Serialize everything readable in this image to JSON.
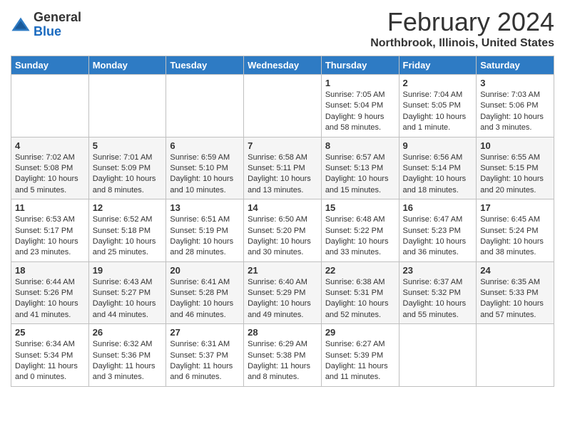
{
  "app": {
    "logo_general": "General",
    "logo_blue": "Blue"
  },
  "header": {
    "month": "February 2024",
    "location": "Northbrook, Illinois, United States"
  },
  "weekdays": [
    "Sunday",
    "Monday",
    "Tuesday",
    "Wednesday",
    "Thursday",
    "Friday",
    "Saturday"
  ],
  "weeks": [
    [
      {
        "day": "",
        "info": ""
      },
      {
        "day": "",
        "info": ""
      },
      {
        "day": "",
        "info": ""
      },
      {
        "day": "",
        "info": ""
      },
      {
        "day": "1",
        "info": "Sunrise: 7:05 AM\nSunset: 5:04 PM\nDaylight: 9 hours\nand 58 minutes."
      },
      {
        "day": "2",
        "info": "Sunrise: 7:04 AM\nSunset: 5:05 PM\nDaylight: 10 hours\nand 1 minute."
      },
      {
        "day": "3",
        "info": "Sunrise: 7:03 AM\nSunset: 5:06 PM\nDaylight: 10 hours\nand 3 minutes."
      }
    ],
    [
      {
        "day": "4",
        "info": "Sunrise: 7:02 AM\nSunset: 5:08 PM\nDaylight: 10 hours\nand 5 minutes."
      },
      {
        "day": "5",
        "info": "Sunrise: 7:01 AM\nSunset: 5:09 PM\nDaylight: 10 hours\nand 8 minutes."
      },
      {
        "day": "6",
        "info": "Sunrise: 6:59 AM\nSunset: 5:10 PM\nDaylight: 10 hours\nand 10 minutes."
      },
      {
        "day": "7",
        "info": "Sunrise: 6:58 AM\nSunset: 5:11 PM\nDaylight: 10 hours\nand 13 minutes."
      },
      {
        "day": "8",
        "info": "Sunrise: 6:57 AM\nSunset: 5:13 PM\nDaylight: 10 hours\nand 15 minutes."
      },
      {
        "day": "9",
        "info": "Sunrise: 6:56 AM\nSunset: 5:14 PM\nDaylight: 10 hours\nand 18 minutes."
      },
      {
        "day": "10",
        "info": "Sunrise: 6:55 AM\nSunset: 5:15 PM\nDaylight: 10 hours\nand 20 minutes."
      }
    ],
    [
      {
        "day": "11",
        "info": "Sunrise: 6:53 AM\nSunset: 5:17 PM\nDaylight: 10 hours\nand 23 minutes."
      },
      {
        "day": "12",
        "info": "Sunrise: 6:52 AM\nSunset: 5:18 PM\nDaylight: 10 hours\nand 25 minutes."
      },
      {
        "day": "13",
        "info": "Sunrise: 6:51 AM\nSunset: 5:19 PM\nDaylight: 10 hours\nand 28 minutes."
      },
      {
        "day": "14",
        "info": "Sunrise: 6:50 AM\nSunset: 5:20 PM\nDaylight: 10 hours\nand 30 minutes."
      },
      {
        "day": "15",
        "info": "Sunrise: 6:48 AM\nSunset: 5:22 PM\nDaylight: 10 hours\nand 33 minutes."
      },
      {
        "day": "16",
        "info": "Sunrise: 6:47 AM\nSunset: 5:23 PM\nDaylight: 10 hours\nand 36 minutes."
      },
      {
        "day": "17",
        "info": "Sunrise: 6:45 AM\nSunset: 5:24 PM\nDaylight: 10 hours\nand 38 minutes."
      }
    ],
    [
      {
        "day": "18",
        "info": "Sunrise: 6:44 AM\nSunset: 5:26 PM\nDaylight: 10 hours\nand 41 minutes."
      },
      {
        "day": "19",
        "info": "Sunrise: 6:43 AM\nSunset: 5:27 PM\nDaylight: 10 hours\nand 44 minutes."
      },
      {
        "day": "20",
        "info": "Sunrise: 6:41 AM\nSunset: 5:28 PM\nDaylight: 10 hours\nand 46 minutes."
      },
      {
        "day": "21",
        "info": "Sunrise: 6:40 AM\nSunset: 5:29 PM\nDaylight: 10 hours\nand 49 minutes."
      },
      {
        "day": "22",
        "info": "Sunrise: 6:38 AM\nSunset: 5:31 PM\nDaylight: 10 hours\nand 52 minutes."
      },
      {
        "day": "23",
        "info": "Sunrise: 6:37 AM\nSunset: 5:32 PM\nDaylight: 10 hours\nand 55 minutes."
      },
      {
        "day": "24",
        "info": "Sunrise: 6:35 AM\nSunset: 5:33 PM\nDaylight: 10 hours\nand 57 minutes."
      }
    ],
    [
      {
        "day": "25",
        "info": "Sunrise: 6:34 AM\nSunset: 5:34 PM\nDaylight: 11 hours\nand 0 minutes."
      },
      {
        "day": "26",
        "info": "Sunrise: 6:32 AM\nSunset: 5:36 PM\nDaylight: 11 hours\nand 3 minutes."
      },
      {
        "day": "27",
        "info": "Sunrise: 6:31 AM\nSunset: 5:37 PM\nDaylight: 11 hours\nand 6 minutes."
      },
      {
        "day": "28",
        "info": "Sunrise: 6:29 AM\nSunset: 5:38 PM\nDaylight: 11 hours\nand 8 minutes."
      },
      {
        "day": "29",
        "info": "Sunrise: 6:27 AM\nSunset: 5:39 PM\nDaylight: 11 hours\nand 11 minutes."
      },
      {
        "day": "",
        "info": ""
      },
      {
        "day": "",
        "info": ""
      }
    ]
  ]
}
